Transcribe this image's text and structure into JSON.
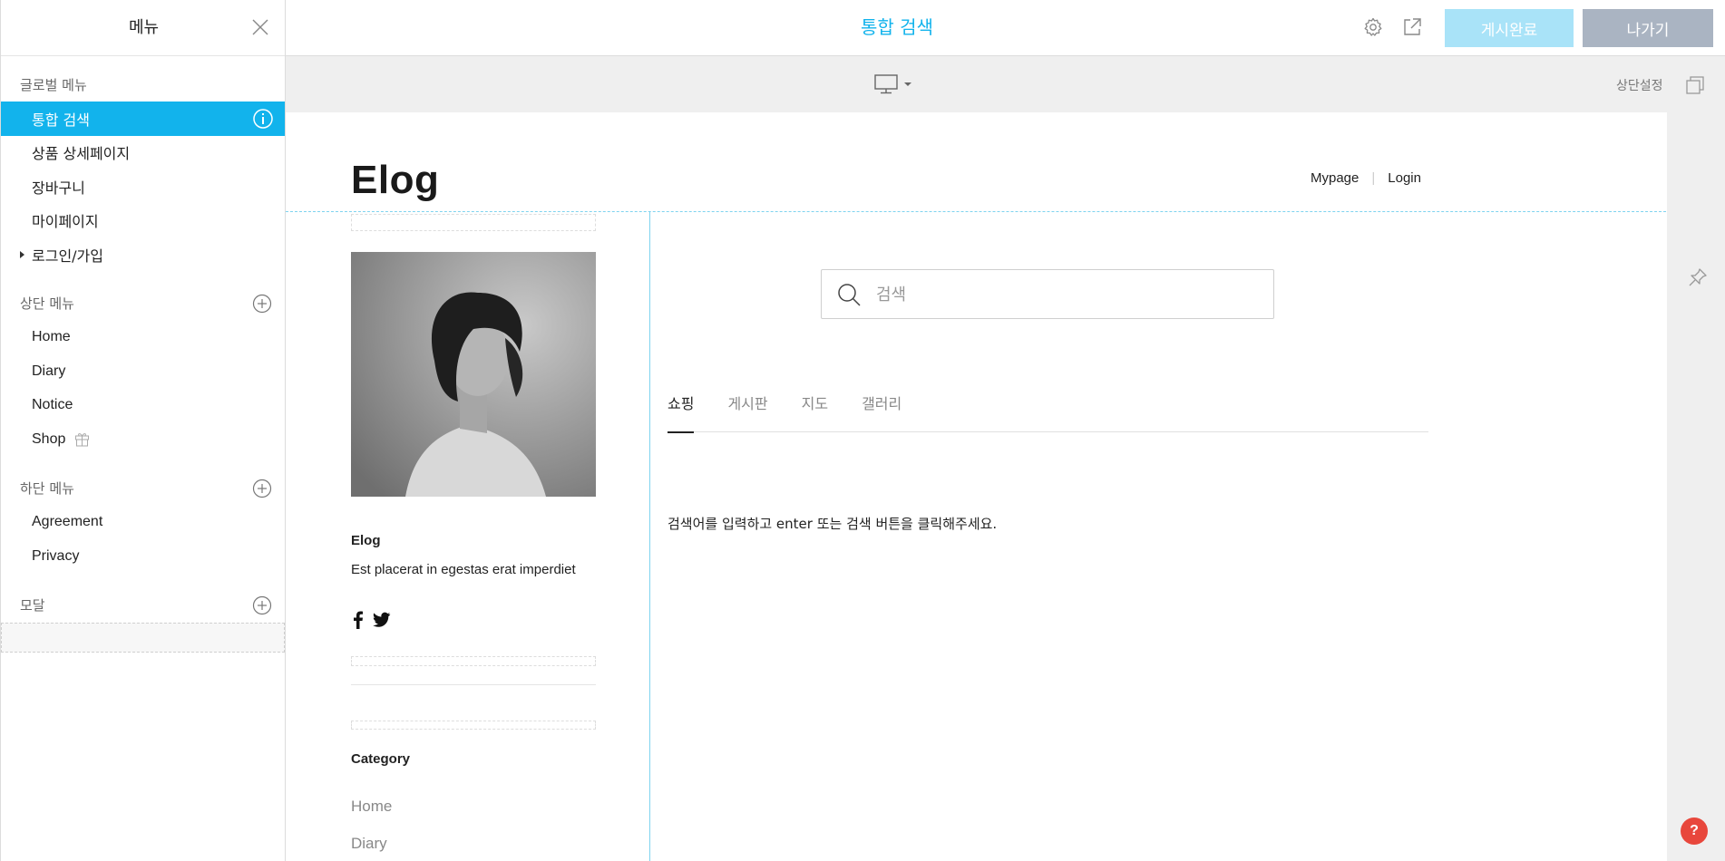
{
  "sidebar": {
    "title": "메뉴",
    "global_section": {
      "label": "글로벌 메뉴",
      "items": [
        {
          "label": "통합 검색",
          "active": true
        },
        {
          "label": "상품 상세페이지"
        },
        {
          "label": "장바구니"
        },
        {
          "label": "마이페이지"
        },
        {
          "label": "로그인/가입",
          "collapsible": true
        }
      ]
    },
    "top_section": {
      "label": "상단 메뉴",
      "items": [
        {
          "label": "Home"
        },
        {
          "label": "Diary"
        },
        {
          "label": "Notice"
        },
        {
          "label": "Shop",
          "icon": "gift-icon"
        }
      ]
    },
    "bottom_section": {
      "label": "하단 메뉴",
      "items": [
        {
          "label": "Agreement"
        },
        {
          "label": "Privacy"
        }
      ]
    },
    "modal_section": {
      "label": "모달"
    }
  },
  "topbar": {
    "title": "통합 검색",
    "publish_label": "게시완료",
    "exit_label": "나가기"
  },
  "subbar": {
    "top_settings_label": "상단설정",
    "device_icon": "desktop-icon"
  },
  "site": {
    "logo": "Elog",
    "nav": [
      "Mypage",
      "Login"
    ],
    "profile": {
      "name": "Elog",
      "description": "Est placerat in egestas erat imperdiet"
    },
    "category": {
      "title": "Category",
      "items": [
        "Home",
        "Diary"
      ]
    },
    "search": {
      "placeholder": "검색",
      "value": ""
    },
    "tabs": [
      "쇼핑",
      "게시판",
      "지도",
      "갤러리"
    ],
    "active_tab": 0,
    "message": "검색어를 입력하고 enter 또는 검색 버튼을 클릭해주세요."
  },
  "help_label": "?",
  "colors": {
    "accent": "#12b3ec",
    "publish_button": "#a9e3f8",
    "exit_button": "#aab4c2",
    "help_button": "#e8473c"
  }
}
